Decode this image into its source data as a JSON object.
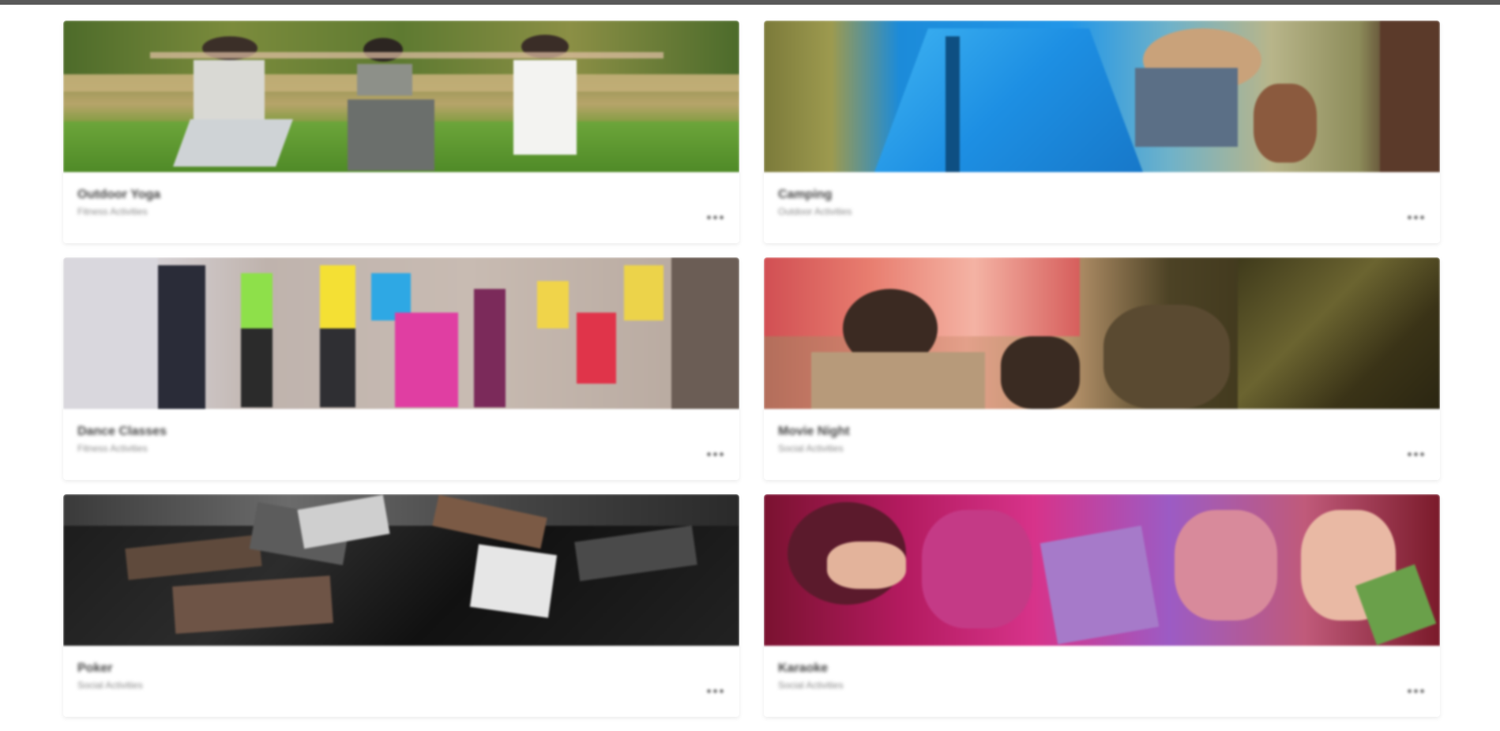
{
  "cards": [
    {
      "title": "Outdoor Yoga",
      "subtitle": "Fitness Activities",
      "menu_icon": "more-horizontal-icon"
    },
    {
      "title": "Camping",
      "subtitle": "Outdoor Activities",
      "menu_icon": "more-horizontal-icon"
    },
    {
      "title": "Dance Classes",
      "subtitle": "Fitness Activities",
      "menu_icon": "more-horizontal-icon"
    },
    {
      "title": "Movie Night",
      "subtitle": "Social Activities",
      "menu_icon": "more-horizontal-icon"
    },
    {
      "title": "Poker",
      "subtitle": "Social Activities",
      "menu_icon": "more-horizontal-icon"
    },
    {
      "title": "Karaoke",
      "subtitle": "Social Activities",
      "menu_icon": "more-horizontal-icon"
    }
  ]
}
